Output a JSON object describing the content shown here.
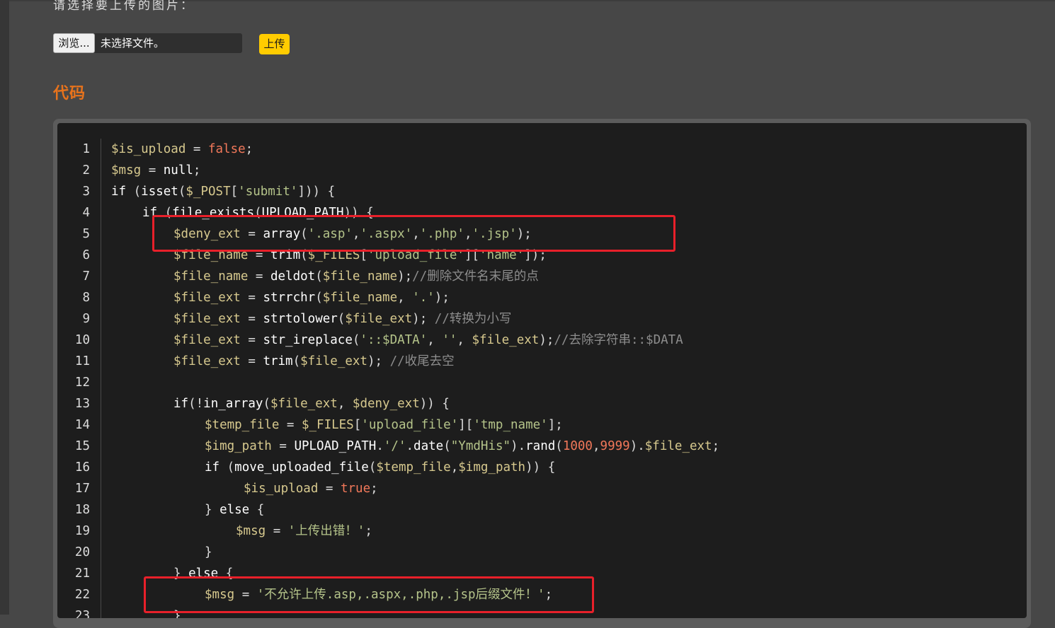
{
  "form": {
    "prompt": "请选择要上传的图片：",
    "browse_label": "浏览...",
    "file_status": "未选择文件。",
    "upload_label": "上传"
  },
  "section": {
    "title": "代码"
  },
  "code": {
    "lines": [
      {
        "n": "1",
        "indent": 0,
        "tokens": [
          [
            "var",
            "$is_upload"
          ],
          [
            "pl",
            " = "
          ],
          [
            "bool",
            "false"
          ],
          [
            "pl",
            ";"
          ]
        ]
      },
      {
        "n": "2",
        "indent": 0,
        "tokens": [
          [
            "var",
            "$msg"
          ],
          [
            "pl",
            " = "
          ],
          [
            "kw",
            "null"
          ],
          [
            "pl",
            ";"
          ]
        ]
      },
      {
        "n": "3",
        "indent": 0,
        "tokens": [
          [
            "kw",
            "if"
          ],
          [
            "pl",
            " ("
          ],
          [
            "fn",
            "isset"
          ],
          [
            "pl",
            "("
          ],
          [
            "var",
            "$_POST"
          ],
          [
            "pl",
            "["
          ],
          [
            "str",
            "'submit'"
          ],
          [
            "pl",
            "])) {"
          ]
        ]
      },
      {
        "n": "4",
        "indent": 1,
        "tokens": [
          [
            "kw",
            "if"
          ],
          [
            "pl",
            " ("
          ],
          [
            "fn",
            "file_exists"
          ],
          [
            "pl",
            "("
          ],
          [
            "kw",
            "UPLOAD_PATH"
          ],
          [
            "pl",
            ")) {"
          ]
        ]
      },
      {
        "n": "5",
        "indent": 2,
        "tokens": [
          [
            "var",
            "$deny_ext"
          ],
          [
            "pl",
            " = "
          ],
          [
            "fn",
            "array"
          ],
          [
            "pl",
            "("
          ],
          [
            "str",
            "'.asp'"
          ],
          [
            "pl",
            ","
          ],
          [
            "str",
            "'.aspx'"
          ],
          [
            "pl",
            ","
          ],
          [
            "str",
            "'.php'"
          ],
          [
            "pl",
            ","
          ],
          [
            "str",
            "'.jsp'"
          ],
          [
            "pl",
            ");"
          ]
        ]
      },
      {
        "n": "6",
        "indent": 2,
        "tokens": [
          [
            "var",
            "$file_name"
          ],
          [
            "pl",
            " = "
          ],
          [
            "fn",
            "trim"
          ],
          [
            "pl",
            "("
          ],
          [
            "var",
            "$_FILES"
          ],
          [
            "pl",
            "["
          ],
          [
            "str",
            "'upload_file'"
          ],
          [
            "pl",
            "]["
          ],
          [
            "str",
            "'name'"
          ],
          [
            "pl",
            "]);"
          ]
        ]
      },
      {
        "n": "7",
        "indent": 2,
        "tokens": [
          [
            "var",
            "$file_name"
          ],
          [
            "pl",
            " = "
          ],
          [
            "fn",
            "deldot"
          ],
          [
            "pl",
            "("
          ],
          [
            "var",
            "$file_name"
          ],
          [
            "pl",
            ");"
          ],
          [
            "cm",
            "//删除文件名末尾的点"
          ]
        ]
      },
      {
        "n": "8",
        "indent": 2,
        "tokens": [
          [
            "var",
            "$file_ext"
          ],
          [
            "pl",
            " = "
          ],
          [
            "fn",
            "strrchr"
          ],
          [
            "pl",
            "("
          ],
          [
            "var",
            "$file_name"
          ],
          [
            "pl",
            ", "
          ],
          [
            "str",
            "'.'"
          ],
          [
            "pl",
            ");"
          ]
        ]
      },
      {
        "n": "9",
        "indent": 2,
        "tokens": [
          [
            "var",
            "$file_ext"
          ],
          [
            "pl",
            " = "
          ],
          [
            "fn",
            "strtolower"
          ],
          [
            "pl",
            "("
          ],
          [
            "var",
            "$file_ext"
          ],
          [
            "pl",
            "); "
          ],
          [
            "cm",
            "//转换为小写"
          ]
        ]
      },
      {
        "n": "10",
        "indent": 2,
        "tokens": [
          [
            "var",
            "$file_ext"
          ],
          [
            "pl",
            " = "
          ],
          [
            "fn",
            "str_ireplace"
          ],
          [
            "pl",
            "("
          ],
          [
            "str",
            "'::$DATA'"
          ],
          [
            "pl",
            ", "
          ],
          [
            "str",
            "''"
          ],
          [
            "pl",
            ", "
          ],
          [
            "var",
            "$file_ext"
          ],
          [
            "pl",
            ");"
          ],
          [
            "cm",
            "//去除字符串::$DATA"
          ]
        ]
      },
      {
        "n": "11",
        "indent": 2,
        "tokens": [
          [
            "var",
            "$file_ext"
          ],
          [
            "pl",
            " = "
          ],
          [
            "fn",
            "trim"
          ],
          [
            "pl",
            "("
          ],
          [
            "var",
            "$file_ext"
          ],
          [
            "pl",
            "); "
          ],
          [
            "cm",
            "//收尾去空"
          ]
        ]
      },
      {
        "n": "12",
        "indent": 0,
        "tokens": []
      },
      {
        "n": "13",
        "indent": 2,
        "tokens": [
          [
            "kw",
            "if"
          ],
          [
            "pl",
            "(!"
          ],
          [
            "fn",
            "in_array"
          ],
          [
            "pl",
            "("
          ],
          [
            "var",
            "$file_ext"
          ],
          [
            "pl",
            ", "
          ],
          [
            "var",
            "$deny_ext"
          ],
          [
            "pl",
            ")) {"
          ]
        ]
      },
      {
        "n": "14",
        "indent": 3,
        "tokens": [
          [
            "var",
            "$temp_file"
          ],
          [
            "pl",
            " = "
          ],
          [
            "var",
            "$_FILES"
          ],
          [
            "pl",
            "["
          ],
          [
            "str",
            "'upload_file'"
          ],
          [
            "pl",
            "]["
          ],
          [
            "str",
            "'tmp_name'"
          ],
          [
            "pl",
            "];"
          ]
        ]
      },
      {
        "n": "15",
        "indent": 3,
        "tokens": [
          [
            "var",
            "$img_path"
          ],
          [
            "pl",
            " = "
          ],
          [
            "kw",
            "UPLOAD_PATH"
          ],
          [
            "pl",
            "."
          ],
          [
            "str",
            "'/'"
          ],
          [
            "pl",
            "."
          ],
          [
            "fn",
            "date"
          ],
          [
            "pl",
            "("
          ],
          [
            "str",
            "\"YmdHis\""
          ],
          [
            "pl",
            ")."
          ],
          [
            "fn",
            "rand"
          ],
          [
            "pl",
            "("
          ],
          [
            "num",
            "1000"
          ],
          [
            "pl",
            ","
          ],
          [
            "num",
            "9999"
          ],
          [
            "pl",
            ")."
          ],
          [
            "var",
            "$file_ext"
          ],
          [
            "pl",
            ";"
          ]
        ]
      },
      {
        "n": "16",
        "indent": 3,
        "tokens": [
          [
            "kw",
            "if"
          ],
          [
            "pl",
            " ("
          ],
          [
            "fn",
            "move_uploaded_file"
          ],
          [
            "pl",
            "("
          ],
          [
            "var",
            "$temp_file"
          ],
          [
            "pl",
            ","
          ],
          [
            "var",
            "$img_path"
          ],
          [
            "pl",
            ")) {"
          ]
        ]
      },
      {
        "n": "17",
        "indent": 4.25,
        "tokens": [
          [
            "var",
            "$is_upload"
          ],
          [
            "pl",
            " = "
          ],
          [
            "bool",
            "true"
          ],
          [
            "pl",
            ";"
          ]
        ]
      },
      {
        "n": "18",
        "indent": 3,
        "tokens": [
          [
            "pl",
            "} "
          ],
          [
            "kw",
            "else"
          ],
          [
            "pl",
            " {"
          ]
        ]
      },
      {
        "n": "19",
        "indent": 4,
        "tokens": [
          [
            "var",
            "$msg"
          ],
          [
            "pl",
            " = "
          ],
          [
            "str",
            "'上传出错！'"
          ],
          [
            "pl",
            ";"
          ]
        ]
      },
      {
        "n": "20",
        "indent": 3,
        "tokens": [
          [
            "pl",
            "}"
          ]
        ]
      },
      {
        "n": "21",
        "indent": 2,
        "tokens": [
          [
            "pl",
            "} "
          ],
          [
            "kw",
            "else"
          ],
          [
            "pl",
            " {"
          ]
        ]
      },
      {
        "n": "22",
        "indent": 3,
        "tokens": [
          [
            "var",
            "$msg"
          ],
          [
            "pl",
            " = "
          ],
          [
            "str",
            "'不允许上传.asp,.aspx,.php,.jsp后缀文件！'"
          ],
          [
            "pl",
            ";"
          ]
        ]
      },
      {
        "n": "23",
        "indent": 2,
        "tokens": [
          [
            "pl",
            "}"
          ]
        ]
      }
    ],
    "highlighted_lines": [
      "5",
      "22"
    ]
  },
  "colors": {
    "background": "#474747",
    "code_background": "#1d1d1d",
    "accent_title": "#e8731c",
    "upload_button": "#ffcc00",
    "highlight_border": "#e8202a"
  }
}
